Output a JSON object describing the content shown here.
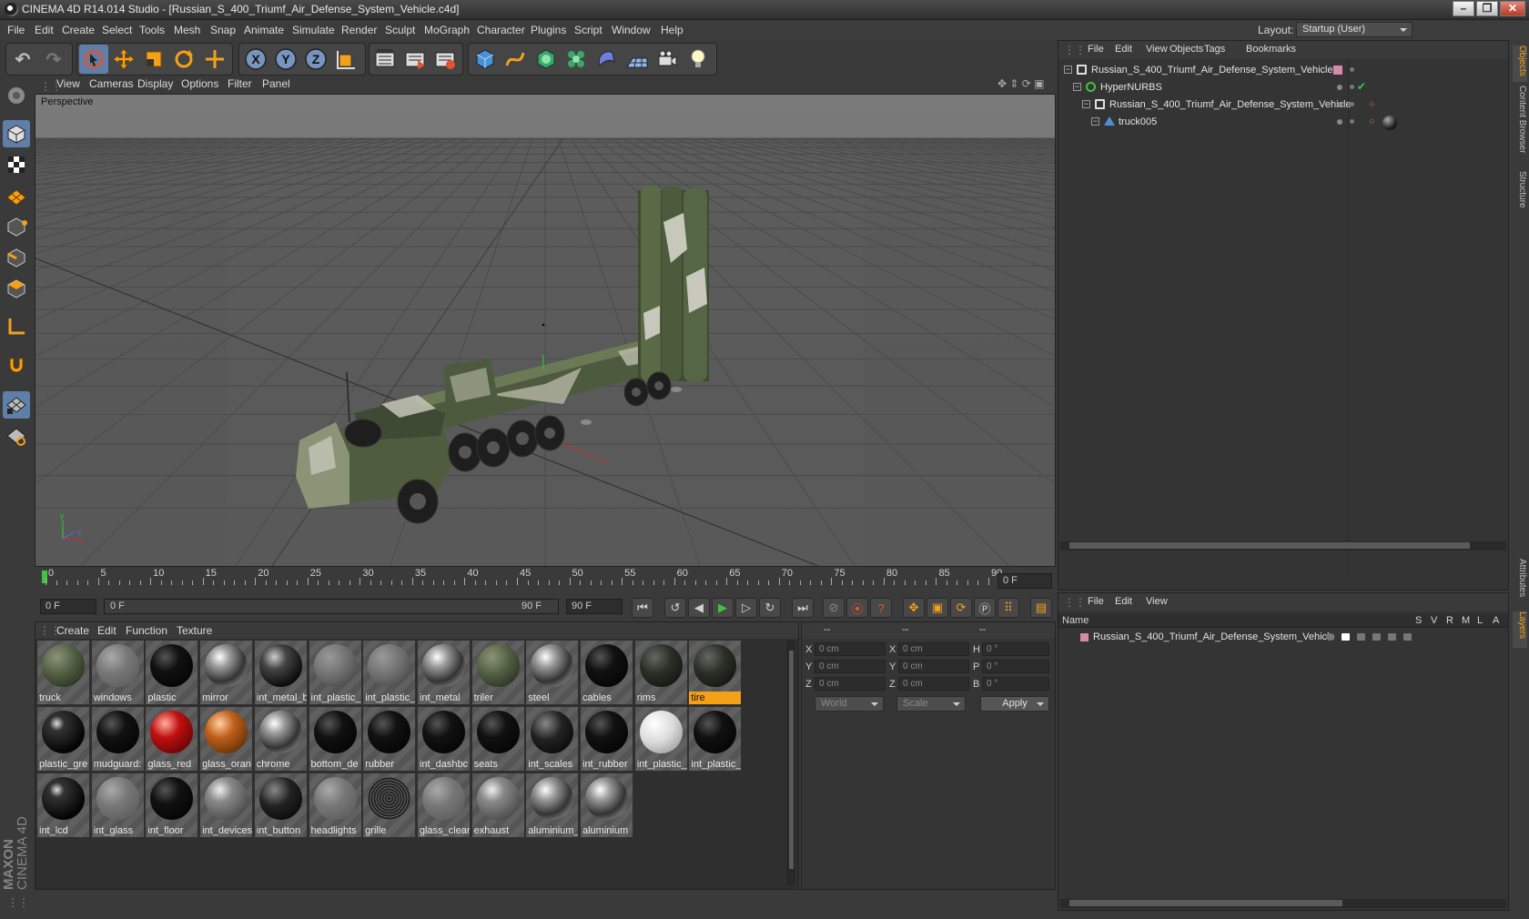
{
  "window": {
    "title": "CINEMA 4D R14.014 Studio - [Russian_S_400_Triumf_Air_Defense_System_Vehicle.c4d]"
  },
  "menu": [
    "File",
    "Edit",
    "Create",
    "Select",
    "Tools",
    "Mesh",
    "Snap",
    "Animate",
    "Simulate",
    "Render",
    "Sculpt",
    "MoGraph",
    "Character",
    "Plugins",
    "Script",
    "Window",
    "Help"
  ],
  "layout": {
    "label": "Layout:",
    "value": "Startup (User)"
  },
  "toolbar": {
    "undo_icon": "undo-icon",
    "redo_icon": "redo-icon",
    "tools": [
      "live-selection-icon",
      "move-icon",
      "scale-icon",
      "rotate-icon",
      "add-icon"
    ],
    "axes": [
      "X",
      "Y",
      "Z"
    ],
    "colors": {
      "accent": "#f4a11a",
      "selected": "#5f7fa8",
      "bg": "#3a3a3a"
    }
  },
  "viewport": {
    "menu": [
      "View",
      "Cameras",
      "Display",
      "Options",
      "Filter",
      "Panel"
    ],
    "label": "Perspective"
  },
  "timeline": {
    "ticks": [
      "0",
      "5",
      "10",
      "15",
      "20",
      "25",
      "30",
      "35",
      "40",
      "45",
      "50",
      "55",
      "60",
      "65",
      "70",
      "75",
      "80",
      "85",
      "90"
    ],
    "current_field": "0 F",
    "start_field": "0 F",
    "range_start": "0 F",
    "range_end": "90 F",
    "end_field": "90 F"
  },
  "materials": {
    "menu": [
      "Create",
      "Edit",
      "Function",
      "Texture"
    ],
    "items": [
      {
        "label": "truck",
        "style": "camo",
        "selected": false
      },
      {
        "label": "windows",
        "style": "glass",
        "selected": false
      },
      {
        "label": "plastic",
        "style": "black",
        "selected": false
      },
      {
        "label": "mirror",
        "style": "chrome",
        "selected": false
      },
      {
        "label": "int_metal_b",
        "style": "darkchrome",
        "selected": false
      },
      {
        "label": "int_plastic_",
        "style": "grey",
        "selected": false
      },
      {
        "label": "int_plastic_",
        "style": "grey",
        "selected": false
      },
      {
        "label": "int_metal",
        "style": "chrome",
        "selected": false
      },
      {
        "label": "triler",
        "style": "camo",
        "selected": false
      },
      {
        "label": "steel",
        "style": "chrome",
        "selected": false
      },
      {
        "label": "cables",
        "style": "black",
        "selected": false
      },
      {
        "label": "rims",
        "style": "darkgreen",
        "selected": false
      },
      {
        "label": "tire",
        "style": "darkgreen",
        "selected": true
      },
      {
        "label": "plastic_gre",
        "style": "blackshiny",
        "selected": false
      },
      {
        "label": "mudguard:",
        "style": "black",
        "selected": false
      },
      {
        "label": "glass_red",
        "style": "red",
        "selected": false
      },
      {
        "label": "glass_oran",
        "style": "orange",
        "selected": false
      },
      {
        "label": "chrome",
        "style": "chrome",
        "selected": false
      },
      {
        "label": "bottom_de",
        "style": "black",
        "selected": false
      },
      {
        "label": "rubber",
        "style": "black",
        "selected": false
      },
      {
        "label": "int_dashbc",
        "style": "black",
        "selected": false
      },
      {
        "label": "seats",
        "style": "black",
        "selected": false
      },
      {
        "label": "int_scales",
        "style": "dotted",
        "selected": false
      },
      {
        "label": "int_rubber",
        "style": "black",
        "selected": false
      },
      {
        "label": "int_plastic_",
        "style": "white",
        "selected": false
      },
      {
        "label": "int_plastic_",
        "style": "black",
        "selected": false
      },
      {
        "label": "int_lcd",
        "style": "blackshiny",
        "selected": false
      },
      {
        "label": "int_glass",
        "style": "glass",
        "selected": false
      },
      {
        "label": "int_floor",
        "style": "black",
        "selected": false
      },
      {
        "label": "int_devices",
        "style": "greyshiny",
        "selected": false
      },
      {
        "label": "int_button",
        "style": "dotted",
        "selected": false
      },
      {
        "label": "headlights",
        "style": "glass",
        "selected": false
      },
      {
        "label": "grille",
        "style": "mesh",
        "selected": false
      },
      {
        "label": "glass_clear",
        "style": "glass",
        "selected": false
      },
      {
        "label": "exhaust",
        "style": "greyshiny",
        "selected": false
      },
      {
        "label": "aluminium_",
        "style": "chrome",
        "selected": false
      },
      {
        "label": "aluminium",
        "style": "chrome",
        "selected": false
      }
    ]
  },
  "coordinates": {
    "headers": [
      "--",
      "--",
      "--"
    ],
    "rows": [
      {
        "a": "X",
        "av": "0 cm",
        "b": "X",
        "bv": "0 cm",
        "c": "H",
        "cv": "0 °"
      },
      {
        "a": "Y",
        "av": "0 cm",
        "b": "Y",
        "bv": "0 cm",
        "c": "P",
        "cv": "0 °"
      },
      {
        "a": "Z",
        "av": "0 cm",
        "b": "Z",
        "bv": "0 cm",
        "c": "B",
        "cv": "0 °"
      }
    ],
    "space": "World",
    "mode": "Scale",
    "apply": "Apply"
  },
  "objects": {
    "menu": [
      "File",
      "Edit",
      "View",
      "Objects",
      "Tags",
      "Bookmarks"
    ],
    "rows": [
      {
        "label": "Russian_S_400_Triumf_Air_Defense_System_Vehicle",
        "icon": "null-object-icon"
      },
      {
        "label": "HyperNURBS",
        "icon": "hypernurbs-icon"
      },
      {
        "label": "Russian_S_400_Triumf_Air_Defense_System_Vehicle",
        "icon": "null-object-icon"
      },
      {
        "label": "truck005",
        "icon": "polygon-object-icon"
      }
    ]
  },
  "layers": {
    "menu": [
      "File",
      "Edit",
      "View"
    ],
    "header": {
      "name": "Name",
      "cols": [
        "S",
        "V",
        "R",
        "M",
        "L",
        "A"
      ]
    },
    "rows": [
      {
        "label": "Russian_S_400_Triumf_Air_Defense_System_Vehicle",
        "color": "#d48aa8"
      }
    ]
  },
  "side_tabs": [
    "Objects",
    "Content Browser",
    "Structure",
    "Attributes",
    "Layers"
  ],
  "brand": {
    "line1": "MAXON",
    "line2": "CINEMA 4D"
  }
}
